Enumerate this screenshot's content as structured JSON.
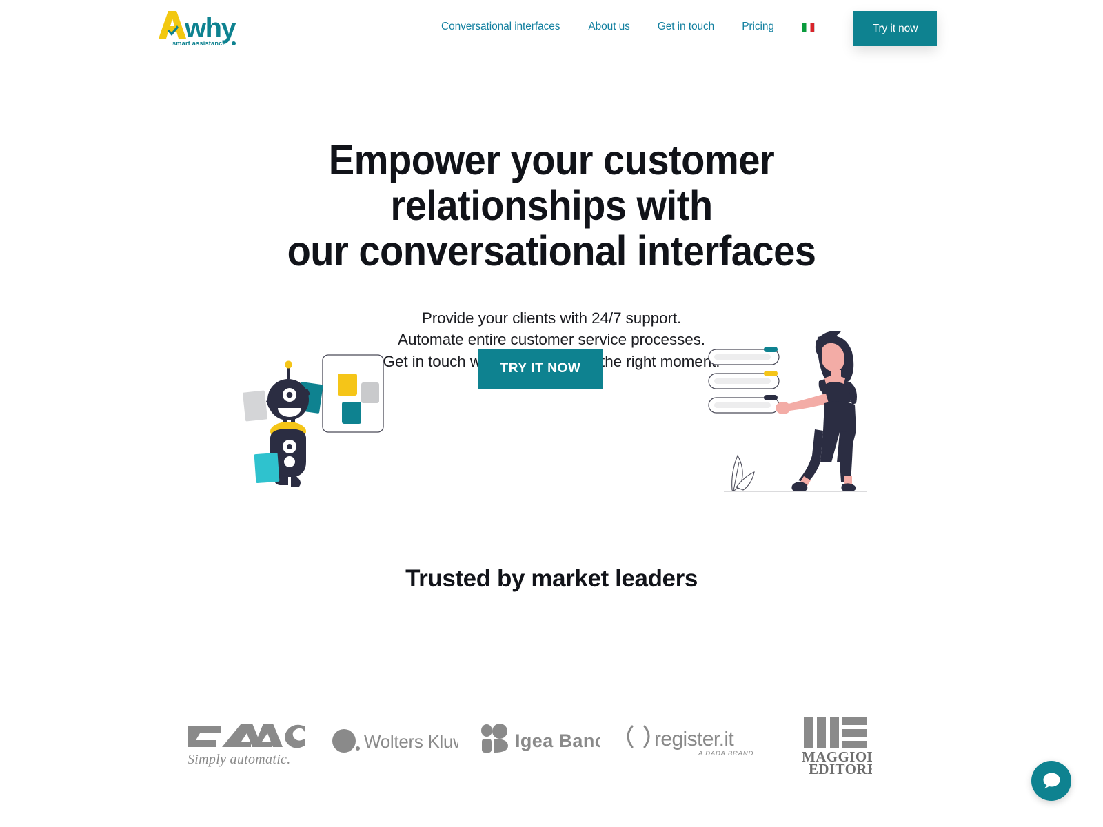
{
  "brand": {
    "name": "Awhy",
    "letter_a": "A",
    "rest": "why",
    "tagline": "smart assistance",
    "color_yellow": "#F2C811",
    "color_teal": "#0E8290"
  },
  "nav": {
    "items": [
      {
        "label": "Conversational interfaces",
        "name": "nav-conversational-interfaces"
      },
      {
        "label": "About us",
        "name": "nav-about-us"
      },
      {
        "label": "Get in touch",
        "name": "nav-get-in-touch"
      },
      {
        "label": "Pricing",
        "name": "nav-pricing"
      }
    ],
    "language": "Italian",
    "language_flag": "it-flag-icon",
    "cta_label": "Try it now"
  },
  "hero": {
    "title_line1": "Empower your customer relationships with",
    "title_line2": "our conversational interfaces",
    "sub_line1": "Provide your clients with 24/7 support.",
    "sub_line2": "Automate entire customer service processes.",
    "sub_line3": "Get in touch with your clients at the right moment.",
    "cta_label": "TRY IT NOW"
  },
  "illustrations": {
    "left": "robot-with-cards-illustration",
    "right": "woman-selecting-options-illustration"
  },
  "trusted": {
    "heading": "Trusted by market leaders",
    "logos": [
      {
        "name": "faac-logo",
        "text": "FAAC",
        "tagline": "Simply automatic."
      },
      {
        "name": "wolters-kluwer-logo",
        "text": "Wolters Kluwer",
        "tagline": ""
      },
      {
        "name": "igea-banca-logo",
        "text": "Igea Banca",
        "tagline": ""
      },
      {
        "name": "register-it-logo",
        "text": "register.it",
        "tagline": "A DADA BRAND"
      },
      {
        "name": "maggioli-editore-logo",
        "text": "MAGGIOLI",
        "tagline": "EDITORE"
      }
    ]
  },
  "chat": {
    "icon": "chat-bubble-icon",
    "color": "#0E8290"
  },
  "colors": {
    "teal": "#0E8290",
    "teal_dark": "#0B7B88",
    "yellow": "#F5C518",
    "navy": "#2B2D42",
    "gray": "#C9CACC",
    "text": "#111319",
    "link": "#1380A0",
    "logo_gray": "#8A8A8A"
  }
}
